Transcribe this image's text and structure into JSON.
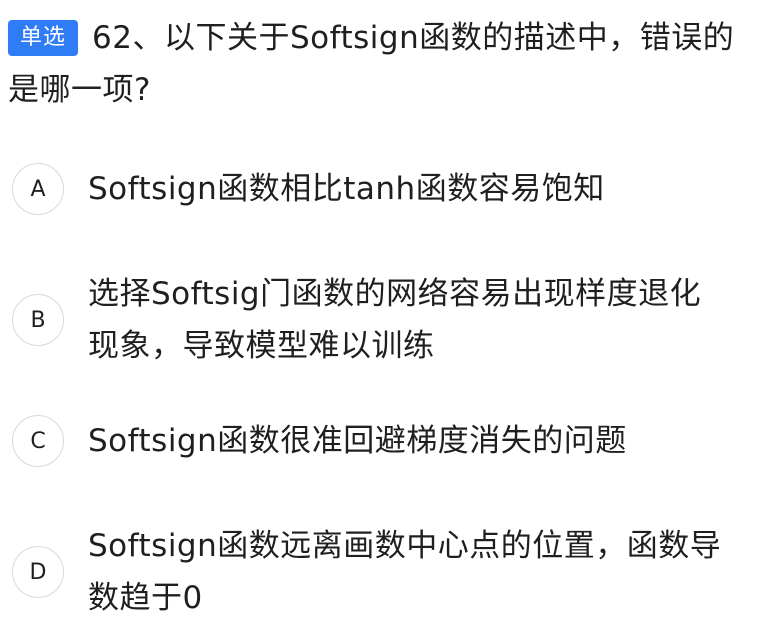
{
  "question": {
    "badge": "单选",
    "text": "62、以下关于Softsign函数的描述中，错误的是哪一项?"
  },
  "options": [
    {
      "letter": "A",
      "text": "Softsign函数相比tanh函数容易饱知"
    },
    {
      "letter": "B",
      "text": "选择Softsig门函数的网络容易出现样度退化现象，导致模型难以训练"
    },
    {
      "letter": "C",
      "text": "Softsign函数很准回避梯度消失的问题"
    },
    {
      "letter": "D",
      "text": "Softsign函数远离画数中心点的位置，函数导数趋于0"
    }
  ]
}
